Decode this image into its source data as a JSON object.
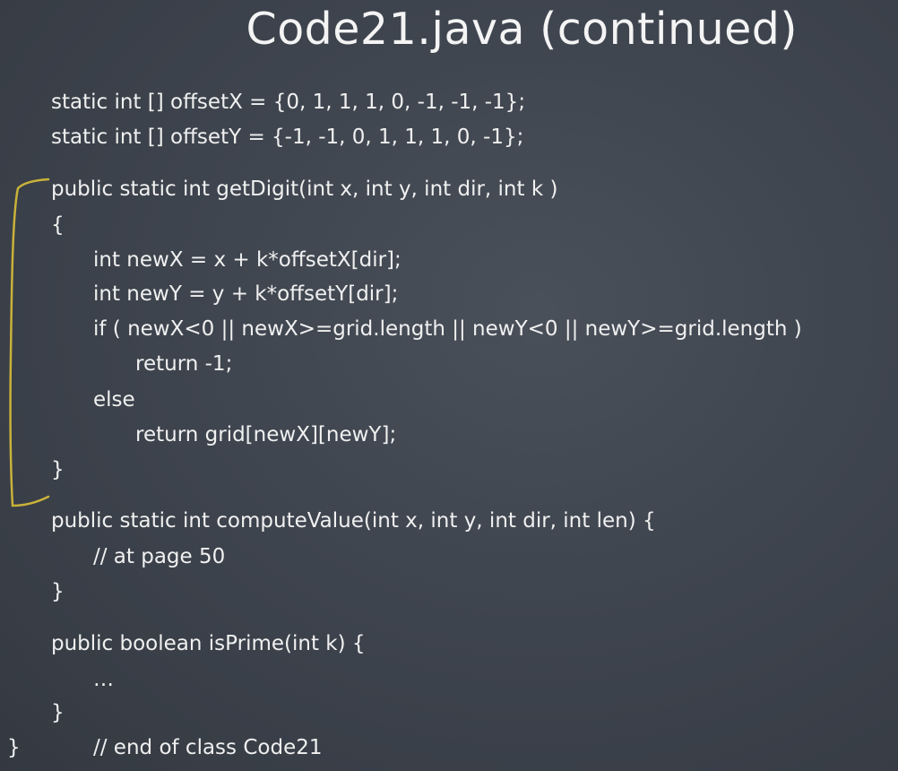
{
  "title": "Code21.java (continued)",
  "code_lines": [
    "static int [] offsetX = {0, 1, 1, 1, 0, -1, -1, -1};",
    "static int [] offsetY = {-1, -1, 0, 1, 1, 1, 0, -1};",
    "public static int getDigit(int x, int y, int dir, int k )",
    "{",
    "int newX = x + k*offsetX[dir];",
    "int newY = y + k*offsetY[dir];",
    "if ( newX<0 || newX>=grid.length || newY<0 || newY>=grid.length )",
    "return -1;",
    "else",
    "return grid[newX][newY];",
    "}",
    "public static int computeValue(int x, int y, int dir, int len) {",
    "// at page 50",
    "}",
    "public boolean isPrime(int k) {",
    "…",
    "}",
    "}",
    "// end of class Code21"
  ],
  "annotation_color": "#c9b23a"
}
